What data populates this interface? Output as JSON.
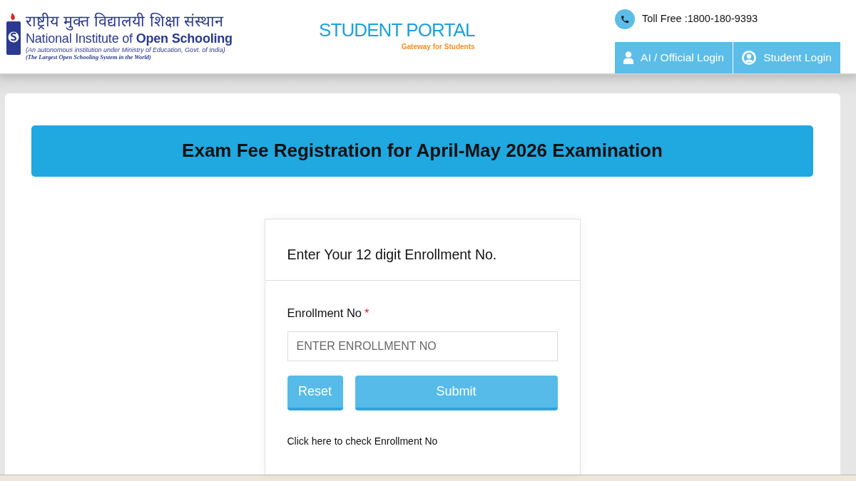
{
  "header": {
    "logo": {
      "hindi_name": "राष्ट्रीय मुक्त विद्यालयी शिक्षा संस्थान",
      "name": "National Institute of **Open Schooling**",
      "tagline": "(An autonomous institution under Ministry of Education, Govt. of India)",
      "motto": "(The Largest Open Schooling System in the World)"
    },
    "portal": {
      "title": "STUDENT PORTAL",
      "subtitle": "Gateway for Students"
    },
    "toll_free": "Toll Free :1800-180-9393",
    "login_buttons": [
      {
        "label": "AI / Official Login",
        "kind": "user"
      },
      {
        "label": "Student Login",
        "kind": "user-circle"
      }
    ]
  },
  "banner": {
    "title": "Exam Fee Registration for April-May 2026 Examination"
  },
  "form": {
    "heading": "Enter Your 12 digit Enrollment No.",
    "field": {
      "label": "Enrollment No",
      "required_mark": "*",
      "placeholder": "ENTER ENROLLMENT NO"
    },
    "buttons": [
      {
        "label": "Reset",
        "kind": "reset"
      },
      {
        "label": "Submit",
        "kind": "submit"
      }
    ],
    "link": "Click here to check Enrollment No"
  }
}
